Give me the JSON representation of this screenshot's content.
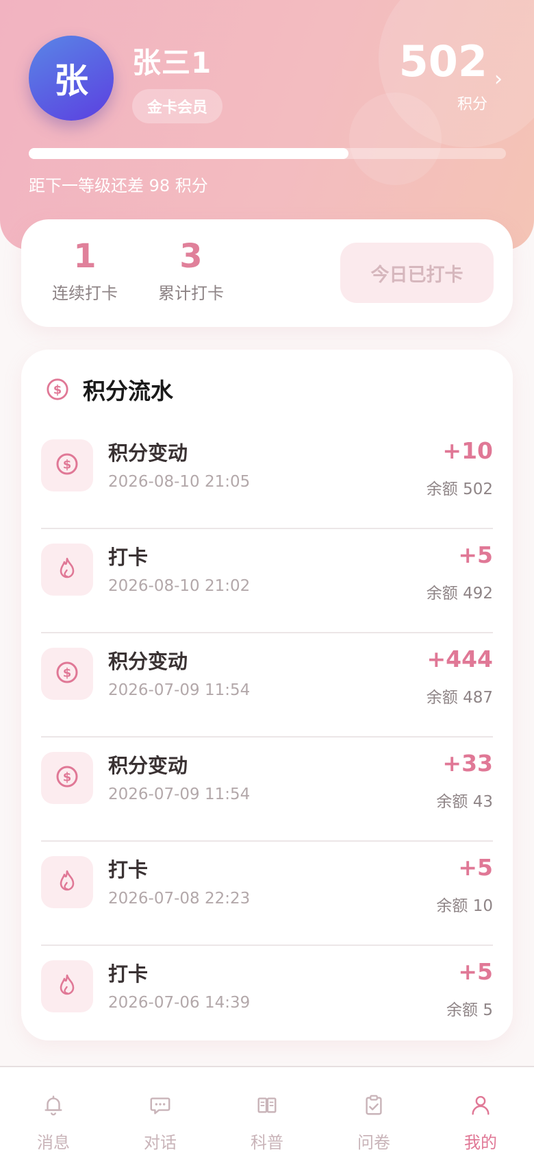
{
  "profile": {
    "avatar_char": "张",
    "name": "张三1",
    "member_level": "金卡会员",
    "points": "502",
    "points_label": "积分",
    "level_progress": 0.67,
    "level_hint": "距下一等级还差 98 积分"
  },
  "checkin": {
    "streak_value": "1",
    "streak_label": "连续打卡",
    "total_value": "3",
    "total_label": "累计打卡",
    "button_label": "今日已打卡"
  },
  "ledger": {
    "title": "积分流水",
    "items": [
      {
        "icon": "coin-icon",
        "title": "积分变动",
        "time": "2026-08-10 21:05",
        "amount": "+10",
        "balance": "余额 502"
      },
      {
        "icon": "flame-icon",
        "title": "打卡",
        "time": "2026-08-10 21:02",
        "amount": "+5",
        "balance": "余额 492"
      },
      {
        "icon": "coin-icon",
        "title": "积分变动",
        "time": "2026-07-09 11:54",
        "amount": "+444",
        "balance": "余额 487"
      },
      {
        "icon": "coin-icon",
        "title": "积分变动",
        "time": "2026-07-09 11:54",
        "amount": "+33",
        "balance": "余额 43"
      },
      {
        "icon": "flame-icon",
        "title": "打卡",
        "time": "2026-07-08 22:23",
        "amount": "+5",
        "balance": "余额 10"
      },
      {
        "icon": "flame-icon",
        "title": "打卡",
        "time": "2026-07-06 14:39",
        "amount": "+5",
        "balance": "余额 5"
      }
    ]
  },
  "nav": {
    "items": [
      {
        "label": "消息",
        "icon": "bell-icon",
        "active": false
      },
      {
        "label": "对话",
        "icon": "chat-icon",
        "active": false
      },
      {
        "label": "科普",
        "icon": "book-icon",
        "active": false
      },
      {
        "label": "问卷",
        "icon": "clipboard-icon",
        "active": false
      },
      {
        "label": "我的",
        "icon": "user-icon",
        "active": true
      }
    ]
  },
  "colors": {
    "accent": "#e07896",
    "nav_inactive": "#c9b4b9",
    "header_gradient_start": "#f2b3c1",
    "header_gradient_end": "#f4c4b5",
    "avatar_gradient_start": "#5a86e6",
    "avatar_gradient_end": "#5b3fe0"
  }
}
